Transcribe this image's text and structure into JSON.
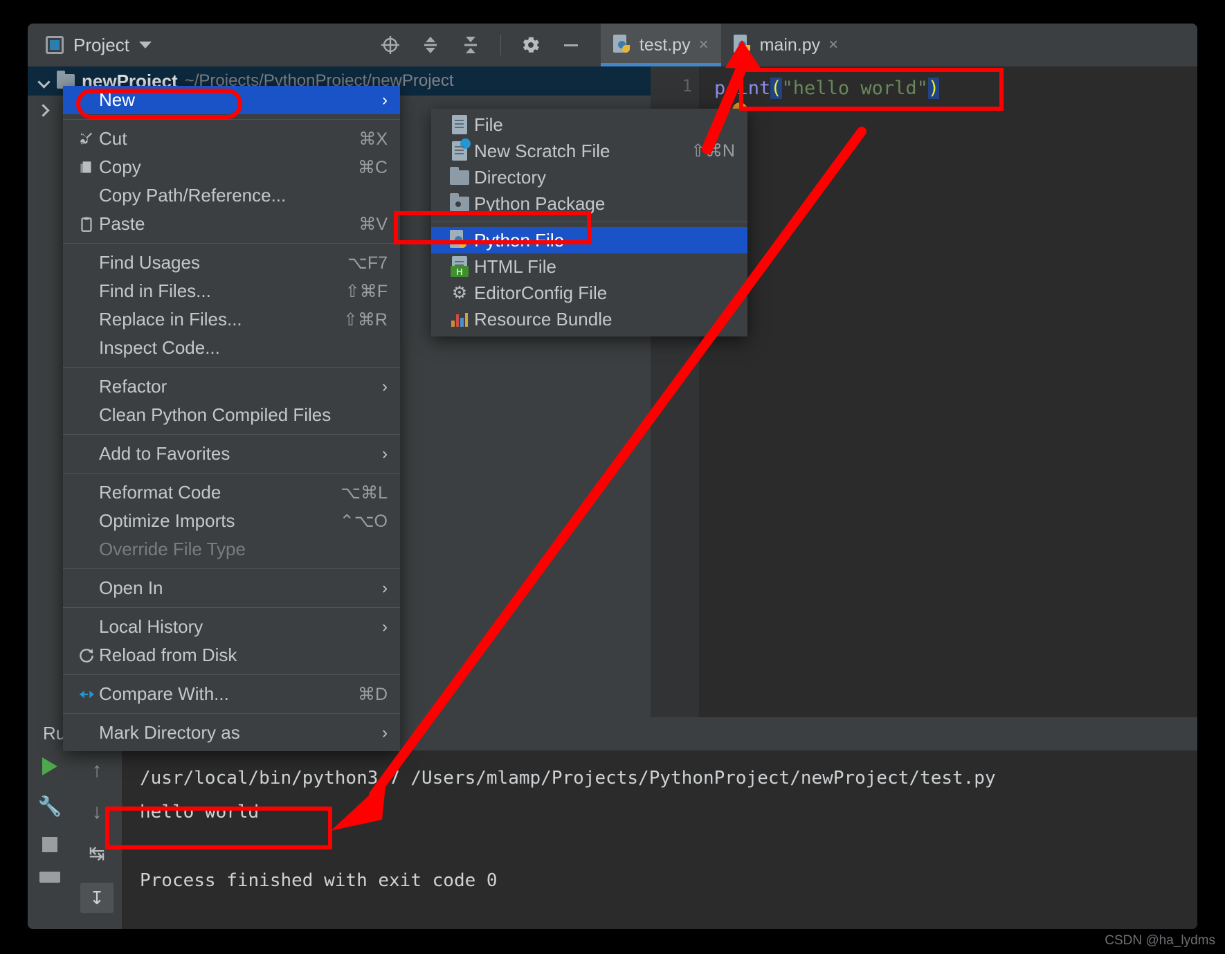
{
  "toolbar": {
    "project_label": "Project",
    "icons": [
      "locate-icon",
      "expand-all-icon",
      "collapse-all-icon",
      "settings-gear-icon",
      "hide-icon"
    ]
  },
  "tabs": [
    {
      "label": "test.py",
      "close": "×",
      "active": true
    },
    {
      "label": "main.py",
      "close": "×",
      "active": false
    }
  ],
  "tree": {
    "project_name": "newProject",
    "project_path": "~/Projects/PythonProject/newProject"
  },
  "editor": {
    "line_number": "1",
    "code": {
      "func": "print",
      "open_paren": "(",
      "string": "\"hello world\"",
      "close_paren": ")"
    }
  },
  "context_menu": {
    "groups": [
      {
        "items": [
          {
            "label": "New",
            "shortcut": "",
            "arrow": "›",
            "icon": "",
            "highlight": true,
            "disabled": false
          }
        ]
      },
      {
        "items": [
          {
            "label": "Cut",
            "shortcut": "⌘X",
            "arrow": "",
            "icon": "scissors-icon",
            "highlight": false,
            "disabled": false
          },
          {
            "label": "Copy",
            "shortcut": "⌘C",
            "arrow": "",
            "icon": "copy-icon",
            "highlight": false,
            "disabled": false
          },
          {
            "label": "Copy Path/Reference...",
            "shortcut": "",
            "arrow": "",
            "icon": "",
            "highlight": false,
            "disabled": false
          },
          {
            "label": "Paste",
            "shortcut": "⌘V",
            "arrow": "",
            "icon": "clipboard-icon",
            "highlight": false,
            "disabled": false
          }
        ]
      },
      {
        "items": [
          {
            "label": "Find Usages",
            "shortcut": "⌥F7",
            "arrow": "",
            "icon": "",
            "highlight": false,
            "disabled": false
          },
          {
            "label": "Find in Files...",
            "shortcut": "⇧⌘F",
            "arrow": "",
            "icon": "",
            "highlight": false,
            "disabled": false
          },
          {
            "label": "Replace in Files...",
            "shortcut": "⇧⌘R",
            "arrow": "",
            "icon": "",
            "highlight": false,
            "disabled": false
          },
          {
            "label": "Inspect Code...",
            "shortcut": "",
            "arrow": "",
            "icon": "",
            "highlight": false,
            "disabled": false
          }
        ]
      },
      {
        "items": [
          {
            "label": "Refactor",
            "shortcut": "",
            "arrow": "›",
            "icon": "",
            "highlight": false,
            "disabled": false
          },
          {
            "label": "Clean Python Compiled Files",
            "shortcut": "",
            "arrow": "",
            "icon": "",
            "highlight": false,
            "disabled": false
          }
        ]
      },
      {
        "items": [
          {
            "label": "Add to Favorites",
            "shortcut": "",
            "arrow": "›",
            "icon": "",
            "highlight": false,
            "disabled": false
          }
        ]
      },
      {
        "items": [
          {
            "label": "Reformat Code",
            "shortcut": "⌥⌘L",
            "arrow": "",
            "icon": "",
            "highlight": false,
            "disabled": false
          },
          {
            "label": "Optimize Imports",
            "shortcut": "⌃⌥O",
            "arrow": "",
            "icon": "",
            "highlight": false,
            "disabled": false
          },
          {
            "label": "Override File Type",
            "shortcut": "",
            "arrow": "",
            "icon": "",
            "highlight": false,
            "disabled": true
          }
        ]
      },
      {
        "items": [
          {
            "label": "Open In",
            "shortcut": "",
            "arrow": "›",
            "icon": "",
            "highlight": false,
            "disabled": false
          }
        ]
      },
      {
        "items": [
          {
            "label": "Local History",
            "shortcut": "",
            "arrow": "›",
            "icon": "",
            "highlight": false,
            "disabled": false
          },
          {
            "label": "Reload from Disk",
            "shortcut": "",
            "arrow": "",
            "icon": "refresh-icon",
            "highlight": false,
            "disabled": false
          }
        ]
      },
      {
        "items": [
          {
            "label": "Compare With...",
            "shortcut": "⌘D",
            "arrow": "",
            "icon": "compare-icon",
            "highlight": false,
            "disabled": false
          }
        ]
      },
      {
        "items": [
          {
            "label": "Mark Directory as",
            "shortcut": "",
            "arrow": "›",
            "icon": "",
            "highlight": false,
            "disabled": false
          }
        ]
      }
    ]
  },
  "submenu": {
    "groups": [
      {
        "items": [
          {
            "label": "File",
            "shortcut": "",
            "icon": "file-icon",
            "highlight": false
          },
          {
            "label": "New Scratch File",
            "shortcut": "⇧⌘N",
            "icon": "scratch-file-icon",
            "highlight": false
          },
          {
            "label": "Directory",
            "shortcut": "",
            "icon": "directory-icon",
            "highlight": false
          },
          {
            "label": "Python Package",
            "shortcut": "",
            "icon": "python-package-icon",
            "highlight": false
          }
        ]
      },
      {
        "items": [
          {
            "label": "Python File",
            "shortcut": "",
            "icon": "python-file-icon",
            "highlight": true
          },
          {
            "label": "HTML File",
            "shortcut": "",
            "icon": "html-file-icon",
            "highlight": false
          },
          {
            "label": "EditorConfig File",
            "shortcut": "",
            "icon": "editorconfig-icon",
            "highlight": false
          },
          {
            "label": "Resource Bundle",
            "shortcut": "",
            "icon": "resource-bundle-icon",
            "highlight": false
          }
        ]
      }
    ]
  },
  "run_panel": {
    "tab_label": "Run",
    "console_lines": [
      "/usr/local/bin/python3.7 /Users/mlamp/Projects/PythonProject/newProject/test.py",
      "hello world",
      "",
      "Process finished with exit code 0"
    ]
  },
  "watermark": "CSDN @ha_lydms",
  "colors": {
    "accent_blue": "#1a53c8",
    "annotation_red": "#ff0000",
    "panel_bg": "#3c3f41",
    "editor_bg": "#2b2b2b",
    "tab_underline": "#4387c7"
  }
}
